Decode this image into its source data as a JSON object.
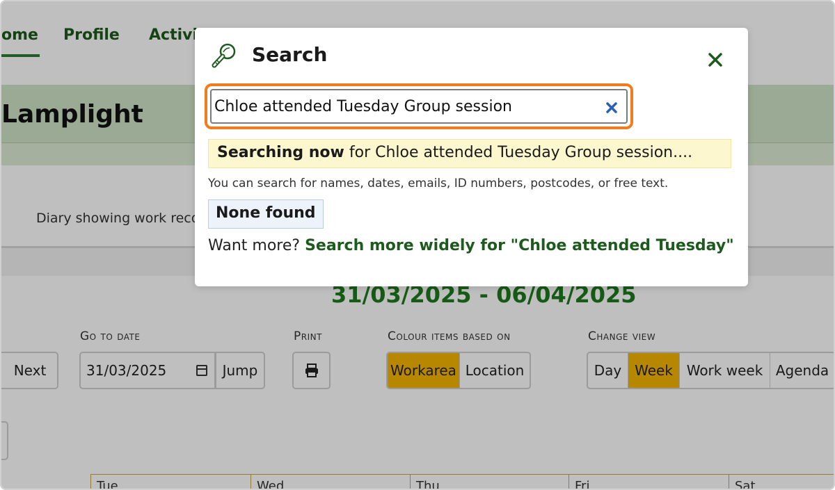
{
  "nav": {
    "items": [
      {
        "label": "ome",
        "active": true
      },
      {
        "label": "Profile",
        "active": false
      },
      {
        "label": "Activi",
        "active": false
      }
    ]
  },
  "banner": {
    "title": "Lamplight"
  },
  "diary": {
    "description": "Diary showing work reco"
  },
  "calendar": {
    "date_range": "31/03/2025 - 06/04/2025",
    "next_label": "Next",
    "go_to_date": {
      "heading": "Go to date",
      "value": "31/03/2025",
      "jump_label": "Jump"
    },
    "print": {
      "heading": "Print"
    },
    "colour_by": {
      "heading": "Colour items based on",
      "options": [
        "Workarea",
        "Location"
      ],
      "selected": "Workarea"
    },
    "change_view": {
      "heading": "Change view",
      "options": [
        "Day",
        "Week",
        "Work week",
        "Agenda"
      ],
      "selected": "Week"
    },
    "day_headers": [
      "Tue",
      "Wed",
      "Thu",
      "Fri",
      "Sat"
    ]
  },
  "search_modal": {
    "title": "Search",
    "query": "Chloe attended Tuesday Group session",
    "status_bold": "Searching now",
    "status_rest": " for Chloe attended Tuesday Group session....",
    "hint": "You can search for names, dates, emails, ID numbers, postcodes, or free text.",
    "none_found": "None found",
    "want_more": "Want more?",
    "search_more_link": "Search more widely for \"Chloe attended Tuesday\""
  },
  "colors": {
    "brand_green": "#1d5a1d",
    "accent_orange": "#f07c1e",
    "selected_gold": "#f4b400",
    "clear_blue": "#2b5fb3"
  },
  "icons": {
    "search": "magnifier-icon",
    "close": "close-icon",
    "clear": "clear-input-icon",
    "print": "printer-icon",
    "calendar": "calendar-icon"
  }
}
